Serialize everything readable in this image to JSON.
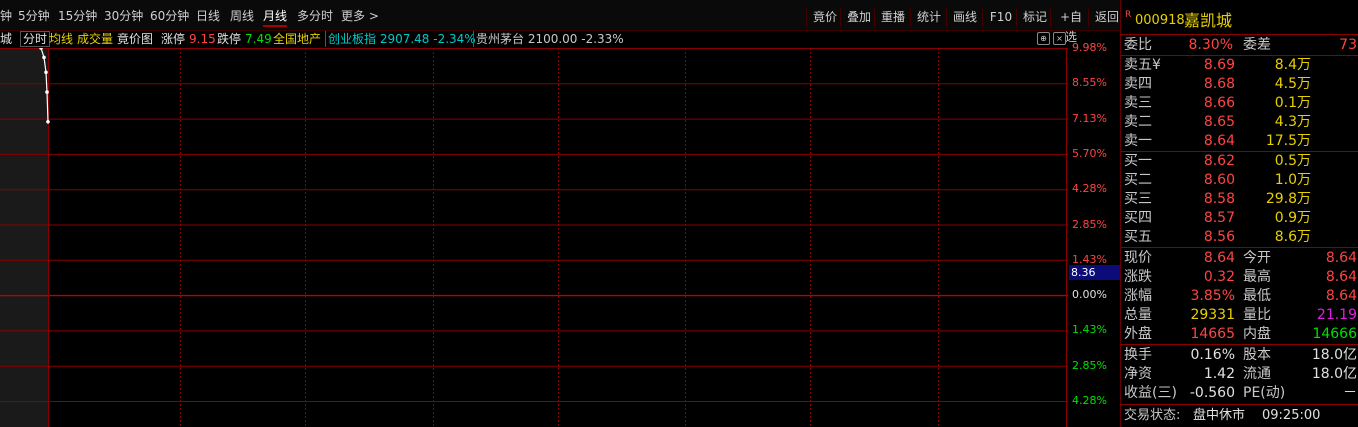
{
  "toolbar": {
    "periods": [
      "钟",
      "5分钟",
      "15分钟",
      "30分钟",
      "60分钟",
      "日线",
      "周线",
      "月线",
      "多分时",
      "更多 >"
    ],
    "active_period": "月线",
    "buttons": [
      "竟价",
      "叠加",
      "重播",
      "统计",
      "画线",
      "F10",
      "标记",
      "+自选",
      "返回"
    ]
  },
  "subbar": {
    "stock_short": "城",
    "tab_fenshi": "分时",
    "junxian": "均线",
    "chengjiaoliang": "成交量",
    "jingjiatu": "竟价图",
    "zhangting_label": "涨停",
    "zhangting_value": "9.15",
    "dieting_label": "跌停",
    "dieting_value": "7.49",
    "sector": "全国地产",
    "index1": "创业板指 2907.48 -2.34%",
    "index2": "贵州茅台 2100.00 -2.33%"
  },
  "axis": {
    "pct_labels": [
      "9.98%",
      "8.55%",
      "7.13%",
      "5.70%",
      "4.28%",
      "2.85%",
      "1.43%",
      "0.00%",
      "1.43%",
      "2.85%",
      "4.28%"
    ],
    "current_price_box": "8.36"
  },
  "chart_data": {
    "type": "line",
    "ylim_pct": [
      -4.28,
      9.98
    ],
    "x": [
      0,
      1,
      2,
      3,
      4
    ],
    "series": [
      {
        "values_pct": [
          9.98,
          9.6,
          9.0,
          8.2,
          7.0
        ]
      }
    ]
  },
  "panel": {
    "r_mark": "R",
    "code": "000918",
    "name": "嘉凯城",
    "weibi_label": "委比",
    "weibi_value": "8.30%",
    "weicha_label": "委差",
    "weicha_value": "73",
    "asks": [
      {
        "label": "卖五¥",
        "price": "8.69",
        "vol": "8.4万"
      },
      {
        "label": "卖四",
        "price": "8.68",
        "vol": "4.5万"
      },
      {
        "label": "卖三",
        "price": "8.66",
        "vol": "0.1万"
      },
      {
        "label": "卖二",
        "price": "8.65",
        "vol": "4.3万"
      },
      {
        "label": "卖一",
        "price": "8.64",
        "vol": "17.5万"
      }
    ],
    "bids": [
      {
        "label": "买一",
        "price": "8.62",
        "vol": "0.5万"
      },
      {
        "label": "买二",
        "price": "8.60",
        "vol": "1.0万"
      },
      {
        "label": "买三",
        "price": "8.58",
        "vol": "29.8万"
      },
      {
        "label": "买四",
        "price": "8.57",
        "vol": "0.9万"
      },
      {
        "label": "买五",
        "price": "8.56",
        "vol": "8.6万"
      }
    ],
    "stats": [
      {
        "l1": "现价",
        "v1": "8.64",
        "c1": "red",
        "l2": "今开",
        "v2": "8.64",
        "c2": "red"
      },
      {
        "l1": "涨跌",
        "v1": "0.32",
        "c1": "red",
        "l2": "最高",
        "v2": "8.64",
        "c2": "red"
      },
      {
        "l1": "涨幅",
        "v1": "3.85%",
        "c1": "red",
        "l2": "最低",
        "v2": "8.64",
        "c2": "red"
      },
      {
        "l1": "总量",
        "v1": "29331",
        "c1": "yel",
        "l2": "量比",
        "v2": "21.19",
        "c2": "mag"
      },
      {
        "l1": "外盘",
        "v1": "14665",
        "c1": "red",
        "l2": "内盘",
        "v2": "14666",
        "c2": "grn"
      }
    ],
    "stats2": [
      {
        "l1": "换手",
        "v1": "0.16%",
        "l2": "股本",
        "v2": "18.0亿"
      },
      {
        "l1": "净资",
        "v1": "1.42",
        "l2": "流通",
        "v2": "18.0亿"
      },
      {
        "l1": "收益(三)",
        "v1": "-0.560",
        "l2": "PE(动)",
        "v2": "－"
      }
    ],
    "status_label": "交易状态:",
    "status_value": "盘中休市",
    "status_time": "09:25:00"
  }
}
